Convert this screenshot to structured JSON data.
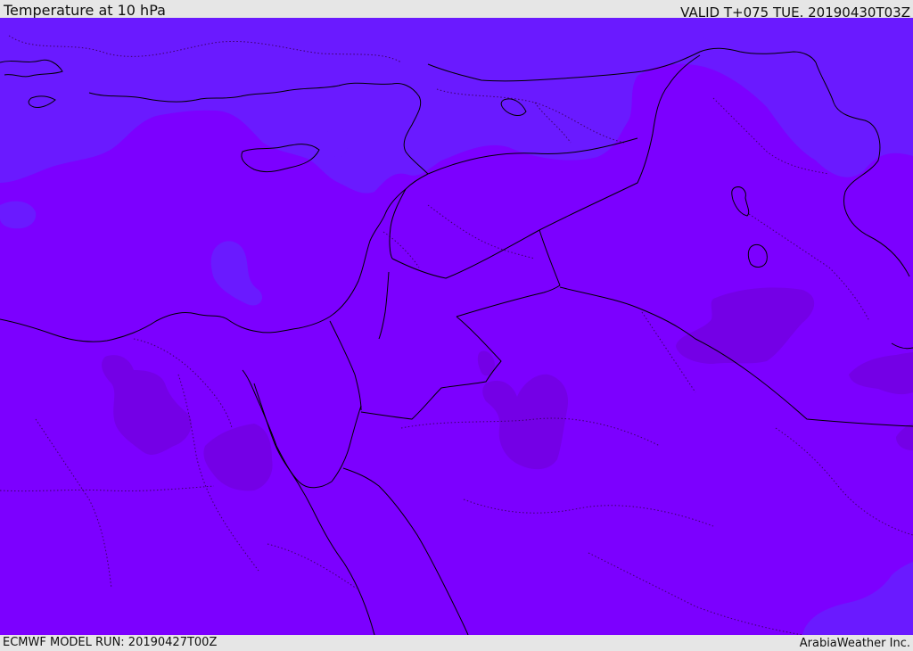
{
  "header": {
    "title": "Temperature at 10 hPa",
    "valid_time": "VALID T+075 TUE. 20190430T03Z"
  },
  "footer": {
    "model_run": "ECMWF MODEL RUN: 20190427T00Z",
    "credit": "ArabiaWeather Inc."
  },
  "map": {
    "field": "temperature",
    "level": "10 hPa",
    "colors": {
      "base_fill": "#7c00ff",
      "cooler_fill": "#6a1aff",
      "warmer_fill": "#7400e6",
      "coastline": "#000000",
      "border": "#3d0066"
    }
  }
}
